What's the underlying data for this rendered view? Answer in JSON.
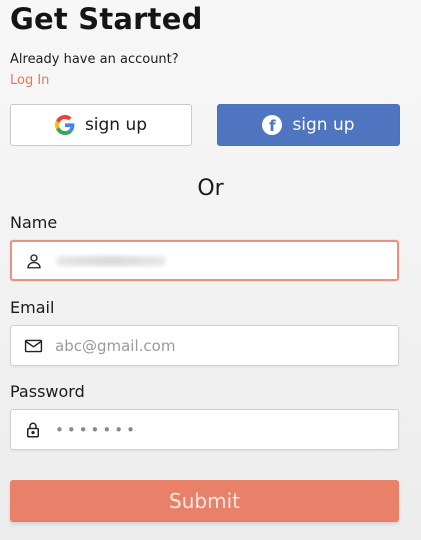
{
  "header": {
    "title": "Get Started",
    "subtitle": "Already have an account?",
    "login_link": "Log In"
  },
  "social": {
    "google_label": "sign up",
    "facebook_label": "sign up",
    "google_icon": "google-icon",
    "facebook_icon": "facebook-icon"
  },
  "divider": {
    "or_text": "Or"
  },
  "form": {
    "name": {
      "label": "Name",
      "value": "",
      "icon": "user-icon"
    },
    "email": {
      "label": "Email",
      "placeholder": "abc@gmail.com",
      "icon": "mail-icon"
    },
    "password": {
      "label": "Password",
      "masked_value": "•••••••",
      "icon": "lock-icon"
    },
    "submit_label": "Submit"
  },
  "colors": {
    "accent": "#e8806a",
    "facebook": "#4f74c0",
    "link": "#e07a5f"
  }
}
